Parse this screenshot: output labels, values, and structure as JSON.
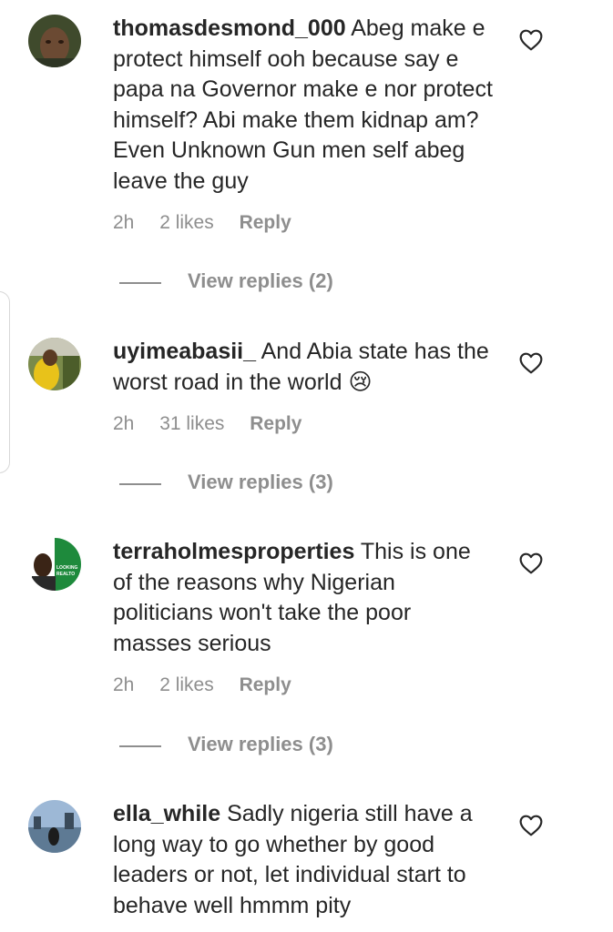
{
  "comments": [
    {
      "username": "thomasdesmond_000",
      "text": "Abeg make e protect himself ooh because say e papa na Governor make e nor protect himself? Abi make them kidnap am? Even Unknown Gun men self abeg leave the guy",
      "time": "2h",
      "likes": "2 likes",
      "reply": "Reply",
      "view_replies": "View replies (2)"
    },
    {
      "username": "uyimeabasii_",
      "text": "And Abia state has the worst road in the world 😢",
      "time": "2h",
      "likes": "31 likes",
      "reply": "Reply",
      "view_replies": "View replies (3)"
    },
    {
      "username": "terraholmesproperties",
      "text": "This is one of the reasons why Nigerian politicians won't take the poor masses serious",
      "time": "2h",
      "likes": "2 likes",
      "reply": "Reply",
      "view_replies": "View replies (3)",
      "avatar_text": [
        "LOOKING",
        "REALTO"
      ]
    },
    {
      "username": "ella_while",
      "text": "Sadly nigeria still have a long way to go whether by good leaders or not, let individual start to behave well hmmm pity"
    }
  ],
  "colors": {
    "text": "#262626",
    "secondary": "#8e8e8e",
    "background": "#ffffff"
  },
  "icons": {
    "like": "heart-outline-icon"
  }
}
